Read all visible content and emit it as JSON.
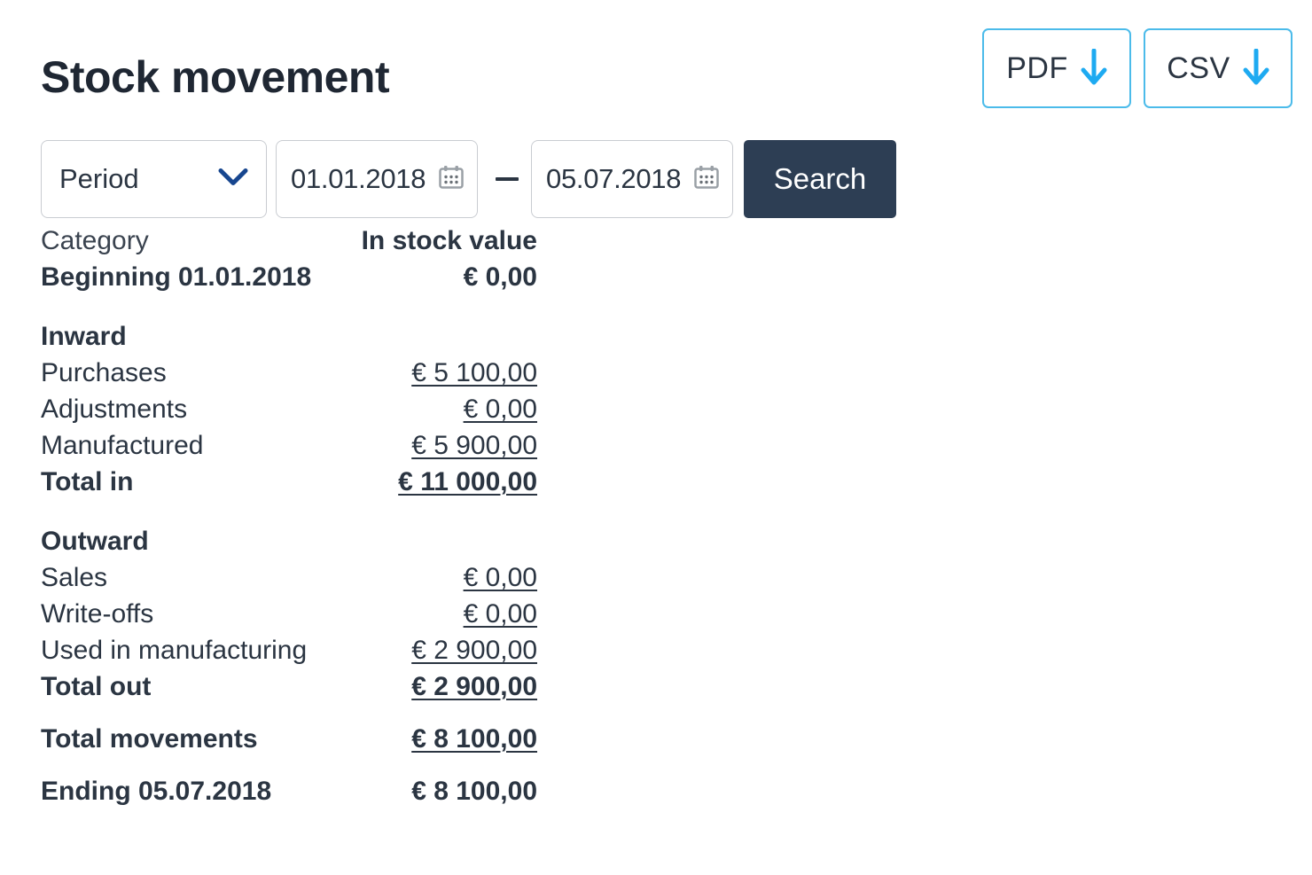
{
  "header": {
    "title": "Stock movement"
  },
  "export": {
    "pdf_label": "PDF",
    "csv_label": "CSV",
    "arrow_icon": "download-arrow-icon",
    "accent_border": "#4bbbea",
    "accent_arrow": "#1eaaf1"
  },
  "filters": {
    "period_label": "Period",
    "period_chevron_icon": "chevron-down-icon",
    "date_from": "01.01.2018",
    "date_to": "05.07.2018",
    "date_separator": "—",
    "calendar_icon": "calendar-icon",
    "search_label": "Search",
    "search_bg": "#2d3e54"
  },
  "table": {
    "col_category": "Category",
    "col_value": "In stock value",
    "beginning_label": "Beginning 01.01.2018",
    "beginning_value": "€ 0,00",
    "inward_heading": "Inward",
    "inward_rows": [
      {
        "label": "Purchases",
        "value": "€ 5 100,00"
      },
      {
        "label": "Adjustments",
        "value": "€ 0,00"
      },
      {
        "label": "Manufactured",
        "value": "€ 5 900,00"
      }
    ],
    "total_in_label": "Total in",
    "total_in_value": "€ 11 000,00",
    "outward_heading": "Outward",
    "outward_rows": [
      {
        "label": "Sales",
        "value": "€ 0,00"
      },
      {
        "label": "Write-offs",
        "value": "€ 0,00"
      },
      {
        "label": "Used in manufacturing",
        "value": "€ 2 900,00"
      }
    ],
    "total_out_label": "Total out",
    "total_out_value": "€ 2 900,00",
    "total_movements_label": "Total movements",
    "total_movements_value": "€ 8 100,00",
    "ending_label": "Ending 05.07.2018",
    "ending_value": "€ 8 100,00"
  }
}
